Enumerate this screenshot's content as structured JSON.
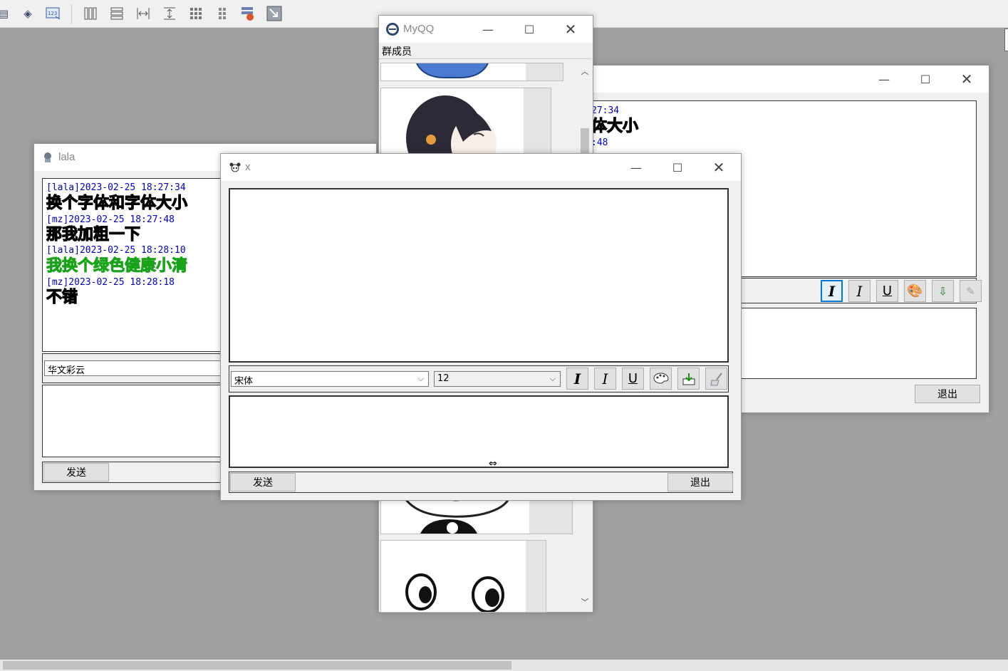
{
  "toolbar": {
    "icons": [
      "file-icon",
      "tag-icon",
      "number-icon",
      "columns-icon",
      "rows-icon",
      "width-icon",
      "height-icon",
      "grid-icon",
      "grid-small-icon",
      "tab-order-icon",
      "resize-icon"
    ]
  },
  "myqq": {
    "title": "MyQQ",
    "menu_label": "群成员"
  },
  "back_window": {
    "time_fragment": "27:34",
    "text_fragment": "体大小",
    "time_fragment2": ":48",
    "exit_label": "退出"
  },
  "lala": {
    "title": "lala",
    "messages": [
      {
        "meta": "[lala]2023-02-25 18:27:34",
        "text": "换个字体和字体大小",
        "style": "outline"
      },
      {
        "meta": "[mz]2023-02-25 18:27:48",
        "text": "那我加粗一下",
        "style": "outline"
      },
      {
        "meta": "[lala]2023-02-25 18:28:10",
        "text": "我换个绿色健康小清",
        "style": "green"
      },
      {
        "meta": "[mz]2023-02-25 18:28:18",
        "text": "不错",
        "style": "outline"
      }
    ],
    "font_value": "华文彩云",
    "send_label": "发送"
  },
  "x_window": {
    "title": "x",
    "font_value": "宋体",
    "size_value": "12",
    "send_label": "发送",
    "exit_label": "退出"
  },
  "colors": {
    "meta_blue": "#0000c8",
    "green_text": "#7de87d",
    "desktop": "#a0a0a0",
    "focus_blue": "#0078d7"
  }
}
